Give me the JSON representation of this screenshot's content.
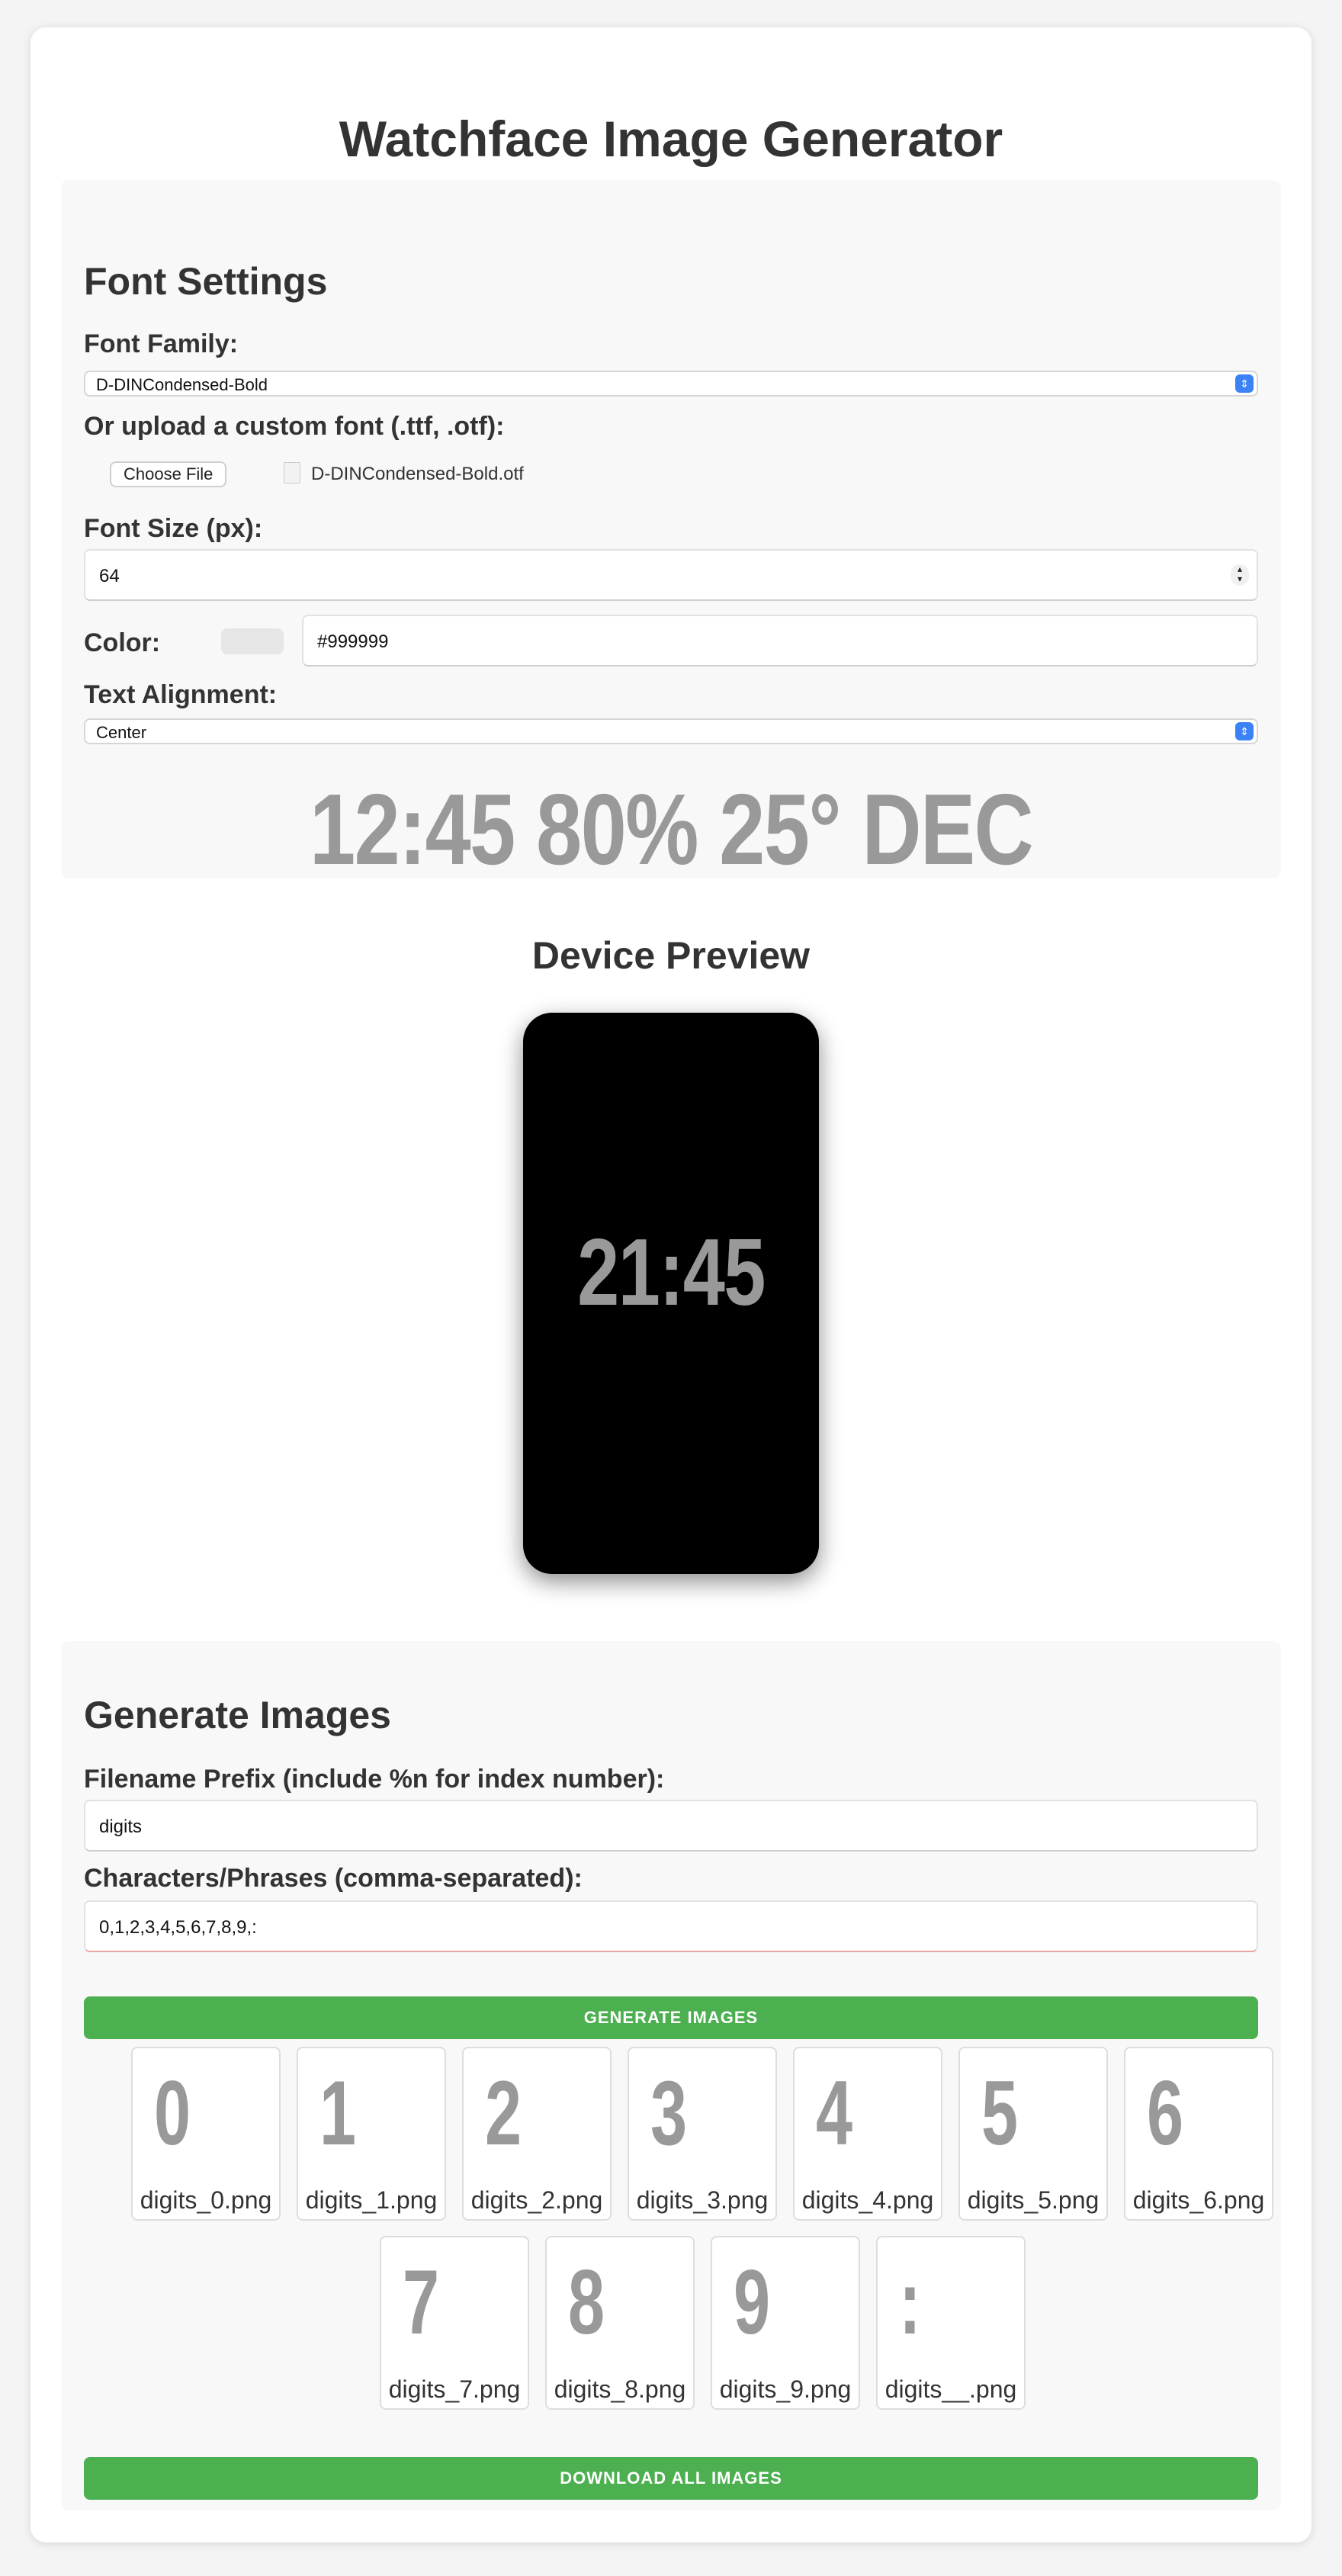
{
  "title": "Watchface Image Generator",
  "font_settings": {
    "heading": "Font Settings",
    "family_label": "Font Family:",
    "family_value": "D-DINCondensed-Bold",
    "upload_label": "Or upload a custom font (.ttf, .otf):",
    "choose_file_label": "Choose File",
    "file_name": "D-DINCondensed-Bold.otf",
    "size_label": "Font Size (px):",
    "size_value": "64",
    "color_label": "Color:",
    "color_value": "#999999",
    "align_label": "Text Alignment:",
    "align_value": "Center",
    "preview_text": "12:45 80% 25° DEC"
  },
  "device": {
    "heading": "Device Preview",
    "time": "21:45"
  },
  "generate": {
    "heading": "Generate Images",
    "prefix_label": "Filename Prefix (include %n for index number):",
    "prefix_value": "digits",
    "chars_label": "Characters/Phrases (comma-separated):",
    "chars_value": "0,1,2,3,4,5,6,7,8,9,:",
    "generate_button": "GENERATE IMAGES",
    "download_button": "DOWNLOAD ALL IMAGES",
    "images": [
      {
        "glyph": "0",
        "filename": "digits_0.png"
      },
      {
        "glyph": "1",
        "filename": "digits_1.png"
      },
      {
        "glyph": "2",
        "filename": "digits_2.png"
      },
      {
        "glyph": "3",
        "filename": "digits_3.png"
      },
      {
        "glyph": "4",
        "filename": "digits_4.png"
      },
      {
        "glyph": "5",
        "filename": "digits_5.png"
      },
      {
        "glyph": "6",
        "filename": "digits_6.png"
      },
      {
        "glyph": "7",
        "filename": "digits_7.png"
      },
      {
        "glyph": "8",
        "filename": "digits_8.png"
      },
      {
        "glyph": "9",
        "filename": "digits_9.png"
      },
      {
        "glyph": ":",
        "filename": "digits__.png"
      }
    ]
  },
  "colors": {
    "accent_button": "#4caf50",
    "text_preview": "#999999",
    "select_chevron": "#3b82f6"
  }
}
